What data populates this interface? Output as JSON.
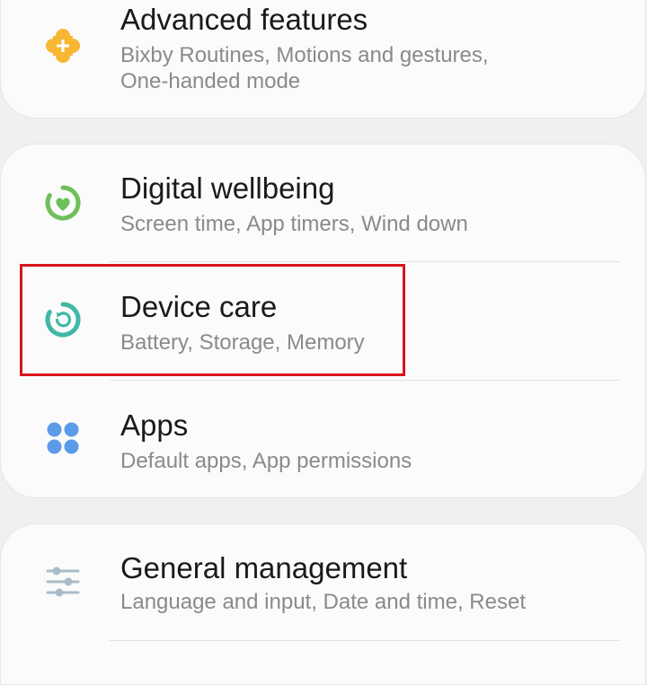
{
  "settings": {
    "advanced_features": {
      "title": "Advanced features",
      "subtitle_line1": "Bixby Routines, Motions and gestures,",
      "subtitle_line2": "One-handed mode",
      "icon": "puzzle-plus-icon"
    },
    "digital_wellbeing": {
      "title": "Digital wellbeing",
      "subtitle": "Screen time, App timers, Wind down",
      "icon": "heart-ring-icon"
    },
    "device_care": {
      "title": "Device care",
      "subtitle": "Battery, Storage, Memory",
      "icon": "refresh-ring-icon"
    },
    "apps": {
      "title": "Apps",
      "subtitle": "Default apps, App permissions",
      "icon": "four-dots-icon"
    },
    "general_management": {
      "title": "General management",
      "subtitle": "Language and input, Date and time, Reset",
      "icon": "sliders-icon"
    }
  },
  "colors": {
    "advanced_icon": "#f7b733",
    "wellbeing_icon": "#6fbf5a",
    "device_care_icon": "#3fb8a6",
    "apps_icon": "#5b9be8",
    "general_icon": "#a9bcc8",
    "highlight": "#d9141c"
  }
}
